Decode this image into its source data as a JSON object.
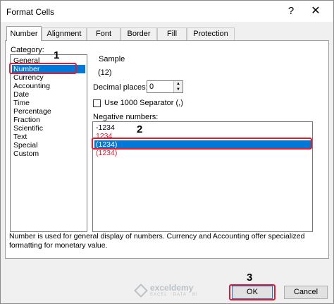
{
  "window": {
    "title": "Format Cells",
    "help_glyph": "?",
    "close_glyph": "✕"
  },
  "tabs": [
    {
      "label": "Number",
      "active": true
    },
    {
      "label": "Alignment"
    },
    {
      "label": "Font"
    },
    {
      "label": "Border"
    },
    {
      "label": "Fill"
    },
    {
      "label": "Protection"
    }
  ],
  "category": {
    "label": "Category:",
    "items": [
      "General",
      "Number",
      "Currency",
      "Accounting",
      "Date",
      "Time",
      "Percentage",
      "Fraction",
      "Scientific",
      "Text",
      "Special",
      "Custom"
    ],
    "selected": "Number"
  },
  "sample": {
    "label": "Sample",
    "value": "(12)"
  },
  "decimal_places": {
    "label": "Decimal places:",
    "value": "0"
  },
  "separator": {
    "label": "Use 1000 Separator (,)",
    "checked": false
  },
  "negative_numbers": {
    "label": "Negative numbers:",
    "items": [
      {
        "text": "-1234",
        "color": "#000000"
      },
      {
        "text": "1234",
        "color": "#e8192c"
      },
      {
        "text": "(1234)",
        "color": "#ffffff",
        "selected": true
      },
      {
        "text": "(1234)",
        "color": "#e8192c"
      }
    ]
  },
  "description": "Number is used for general display of numbers.  Currency and Accounting offer specialized formatting for monetary value.",
  "watermark": {
    "brand": "exceldemy",
    "tagline": "EXCEL · DATA · BI"
  },
  "buttons": {
    "ok": "OK",
    "cancel": "Cancel"
  },
  "annotations": {
    "step1": "1",
    "step2": "2",
    "step3": "3"
  },
  "colors": {
    "selection": "#0078d7",
    "highlight_box": "#e8192c"
  }
}
